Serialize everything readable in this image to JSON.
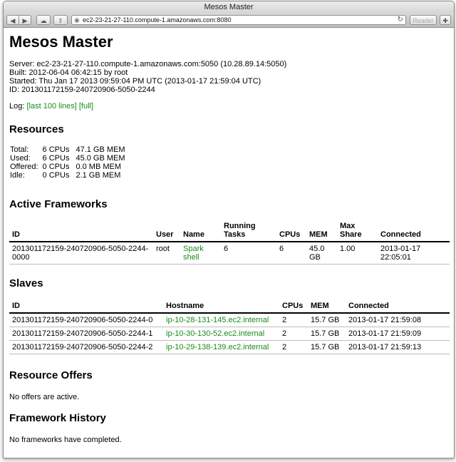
{
  "window": {
    "title": "Mesos Master"
  },
  "toolbar": {
    "url": "ec2-23-21-27-110.compute-1.amazonaws.com:8080",
    "reader_label": "Reader"
  },
  "page": {
    "title": "Mesos Master",
    "server": "Server: ec2-23-21-27-110.compute-1.amazonaws.com:5050 (10.28.89.14:5050)",
    "built": "Built: 2012-06-04 06:42:15 by root",
    "started": "Started: Thu Jan 17 2013 09:59:04 PM UTC (2013-01-17 21:59:04 UTC)",
    "id": "ID: 201301172159-240720906-5050-2244",
    "log_label": "Log:",
    "log_last": "[last 100 lines]",
    "log_full": "[full]"
  },
  "resources": {
    "heading": "Resources",
    "rows": [
      {
        "label": "Total:",
        "cpus": "6 CPUs",
        "mem": "47.1 GB MEM"
      },
      {
        "label": "Used:",
        "cpus": "6 CPUs",
        "mem": "45.0 GB MEM"
      },
      {
        "label": "Offered:",
        "cpus": "0 CPUs",
        "mem": "0.0 MB MEM"
      },
      {
        "label": "Idle:",
        "cpus": "0 CPUs",
        "mem": "2.1 GB MEM"
      }
    ]
  },
  "frameworks": {
    "heading": "Active Frameworks",
    "headers": {
      "id": "ID",
      "user": "User",
      "name": "Name",
      "running": "Running Tasks",
      "cpus": "CPUs",
      "mem": "MEM",
      "share": "Max Share",
      "connected": "Connected"
    },
    "rows": [
      {
        "id": "201301172159-240720906-5050-2244-0000",
        "user": "root",
        "name": "Spark shell",
        "running": "6",
        "cpus": "6",
        "mem": "45.0 GB",
        "share": "1.00",
        "connected": "2013-01-17 22:05:01"
      }
    ]
  },
  "slaves": {
    "heading": "Slaves",
    "headers": {
      "id": "ID",
      "hostname": "Hostname",
      "cpus": "CPUs",
      "mem": "MEM",
      "connected": "Connected"
    },
    "rows": [
      {
        "id": "201301172159-240720906-5050-2244-0",
        "hostname": "ip-10-28-131-145.ec2.internal",
        "cpus": "2",
        "mem": "15.7 GB",
        "connected": "2013-01-17 21:59:08"
      },
      {
        "id": "201301172159-240720906-5050-2244-1",
        "hostname": "ip-10-30-130-52.ec2.internal",
        "cpus": "2",
        "mem": "15.7 GB",
        "connected": "2013-01-17 21:59:09"
      },
      {
        "id": "201301172159-240720906-5050-2244-2",
        "hostname": "ip-10-29-138-139.ec2.internal",
        "cpus": "2",
        "mem": "15.7 GB",
        "connected": "2013-01-17 21:59:13"
      }
    ]
  },
  "offers": {
    "heading": "Resource Offers",
    "empty": "No offers are active."
  },
  "history": {
    "heading": "Framework History",
    "empty": "No frameworks have completed."
  },
  "colors": {
    "link": "#1a8a1a"
  },
  "icons": {
    "back": "back-arrow-icon",
    "forward": "forward-arrow-icon",
    "cloud": "cloud-icon",
    "share": "share-icon",
    "globe": "globe-icon",
    "reload": "reload-icon",
    "extension": "extension-icon"
  }
}
